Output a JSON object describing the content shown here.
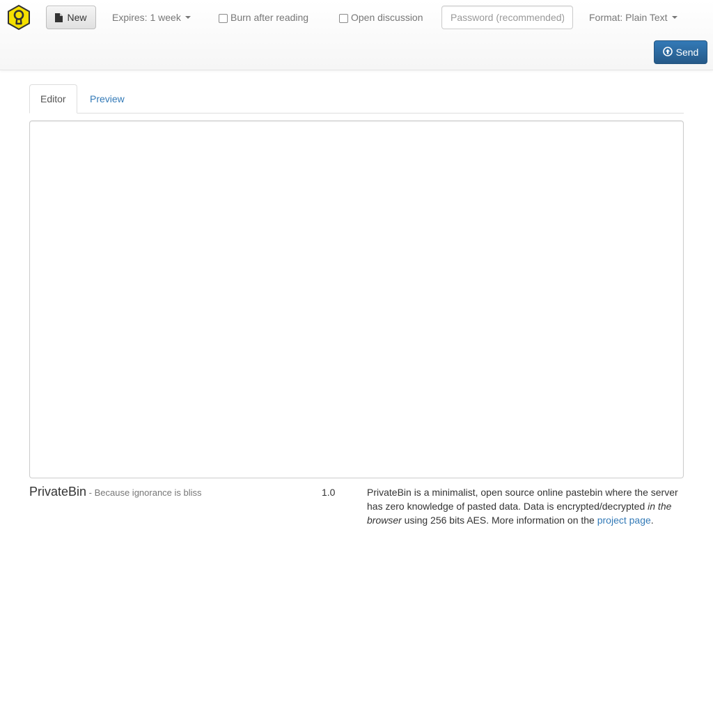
{
  "colors": {
    "primary": "#337ab7",
    "logo_yellow": "#f5e000",
    "muted_text": "#777777"
  },
  "toolbar": {
    "logo_icon": "keyhole-shield-icon",
    "new_label": "New",
    "new_icon": "document-icon",
    "expires_label": "Expires: 1 week",
    "burn_label": "Burn after reading",
    "burn_checked": false,
    "discussion_label": "Open discussion",
    "discussion_checked": false,
    "password_placeholder": "Password (recommended)",
    "password_value": "",
    "format_label": "Format: Plain Text",
    "send_label": "Send",
    "send_icon": "upload-circle-icon"
  },
  "tabs": [
    {
      "label": "Editor",
      "active": true
    },
    {
      "label": "Preview",
      "active": false
    }
  ],
  "editor": {
    "value": ""
  },
  "footer": {
    "brand": "PrivateBin",
    "tagline": " - Because ignorance is bliss",
    "version": "1.0",
    "about_part1": "PrivateBin is a minimalist, open source online pastebin where the server has zero knowledge of pasted data. Data is encrypted/decrypted ",
    "about_em": "in the browser",
    "about_part2": " using 256 bits AES. More information on the ",
    "about_link": "project page",
    "about_end": "."
  }
}
